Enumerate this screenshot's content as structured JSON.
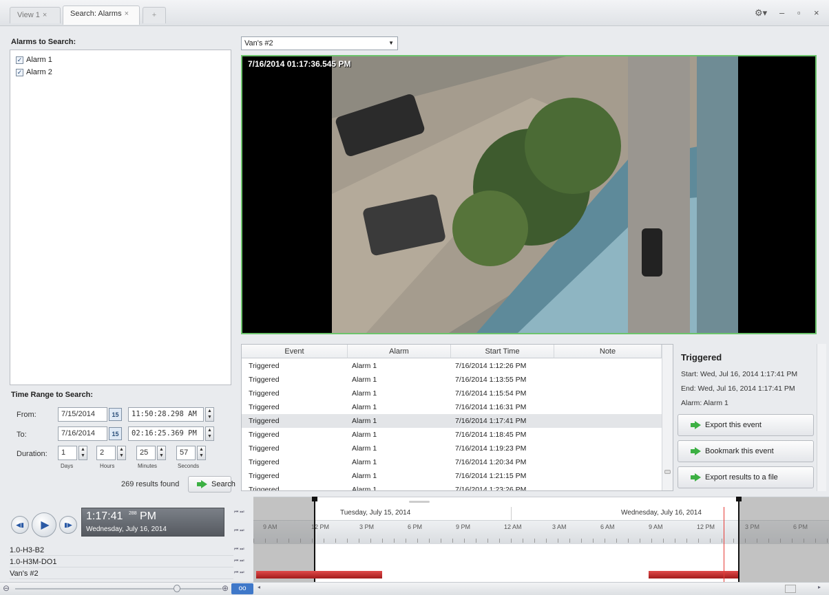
{
  "tabs": [
    {
      "label": "View 1",
      "close": "×",
      "active": false
    },
    {
      "label": "Search: Alarms",
      "close": "×",
      "active": true
    },
    {
      "label": "+"
    }
  ],
  "window_controls": {
    "settings": "⚙▾",
    "minimize": "–",
    "maximize": "▫",
    "close": "×"
  },
  "alarms_panel": {
    "title": "Alarms to Search:",
    "items": [
      {
        "label": "Alarm 1",
        "checked": true
      },
      {
        "label": "Alarm 2",
        "checked": true
      }
    ]
  },
  "time_range": {
    "title": "Time Range to Search:",
    "from_label": "From:",
    "from_date": "7/15/2014",
    "from_time": "11:50:28.298 AM",
    "to_label": "To:",
    "to_date": "7/16/2014",
    "to_time": "02:16:25.369 PM",
    "duration_label": "Duration:",
    "days": "1",
    "hours": "2",
    "minutes": "25",
    "seconds": "57",
    "days_label": "Days",
    "hours_label": "Hours",
    "minutes_label": "Minutes",
    "seconds_label": "Seconds",
    "calendar_icon_text": "15"
  },
  "results": {
    "text": "269 results found",
    "search_label": "Search"
  },
  "camera": {
    "selected": "Van's #2",
    "overlay_timestamp": "7/16/2014 01:17:36.545 PM"
  },
  "grid": {
    "columns": [
      "Event",
      "Alarm",
      "Start Time",
      "Note"
    ],
    "rows": [
      {
        "event": "Triggered",
        "alarm": "Alarm 1",
        "start": "7/16/2014 1:12:26 PM",
        "note": ""
      },
      {
        "event": "Triggered",
        "alarm": "Alarm 1",
        "start": "7/16/2014 1:13:55 PM",
        "note": ""
      },
      {
        "event": "Triggered",
        "alarm": "Alarm 1",
        "start": "7/16/2014 1:15:54 PM",
        "note": ""
      },
      {
        "event": "Triggered",
        "alarm": "Alarm 1",
        "start": "7/16/2014 1:16:31 PM",
        "note": ""
      },
      {
        "event": "Triggered",
        "alarm": "Alarm 1",
        "start": "7/16/2014 1:17:41 PM",
        "note": "",
        "selected": true
      },
      {
        "event": "Triggered",
        "alarm": "Alarm 1",
        "start": "7/16/2014 1:18:45 PM",
        "note": ""
      },
      {
        "event": "Triggered",
        "alarm": "Alarm 1",
        "start": "7/16/2014 1:19:23 PM",
        "note": ""
      },
      {
        "event": "Triggered",
        "alarm": "Alarm 1",
        "start": "7/16/2014 1:20:34 PM",
        "note": ""
      },
      {
        "event": "Triggered",
        "alarm": "Alarm 1",
        "start": "7/16/2014 1:21:15 PM",
        "note": ""
      },
      {
        "event": "Triggered",
        "alarm": "Alarm 1",
        "start": "7/16/2014 1:23:26 PM",
        "note": ""
      }
    ]
  },
  "details": {
    "title": "Triggered",
    "start": "Start:   Wed, Jul 16, 2014 1:17:41 PM",
    "end": "End:    Wed, Jul 16, 2014 1:17:41 PM",
    "alarm": "Alarm: Alarm 1",
    "buttons": [
      "Export this event",
      "Bookmark this event",
      "Export results to a file"
    ]
  },
  "player": {
    "time": "1:17:41",
    "ms": "288",
    "ampm": "PM",
    "date": "Wednesday, July 16, 2014"
  },
  "cameras_list": [
    "1.0-H3-B2",
    "1.0-H3M-DO1",
    "Van's #2"
  ],
  "timeline": {
    "day1": "Tuesday, July 15, 2014",
    "day2": "Wednesday, July 16, 2014",
    "ticks": [
      "9 AM",
      "12 PM",
      "3 PM",
      "6 PM",
      "9 PM",
      "12 AM",
      "3 AM",
      "6 AM",
      "9 AM",
      "12 PM",
      "3 PM",
      "6 PM"
    ]
  },
  "colors": {
    "accent": "#3cb043",
    "video_border": "#6cc46c",
    "recording": "#c62828",
    "cursor": "#e53935"
  }
}
